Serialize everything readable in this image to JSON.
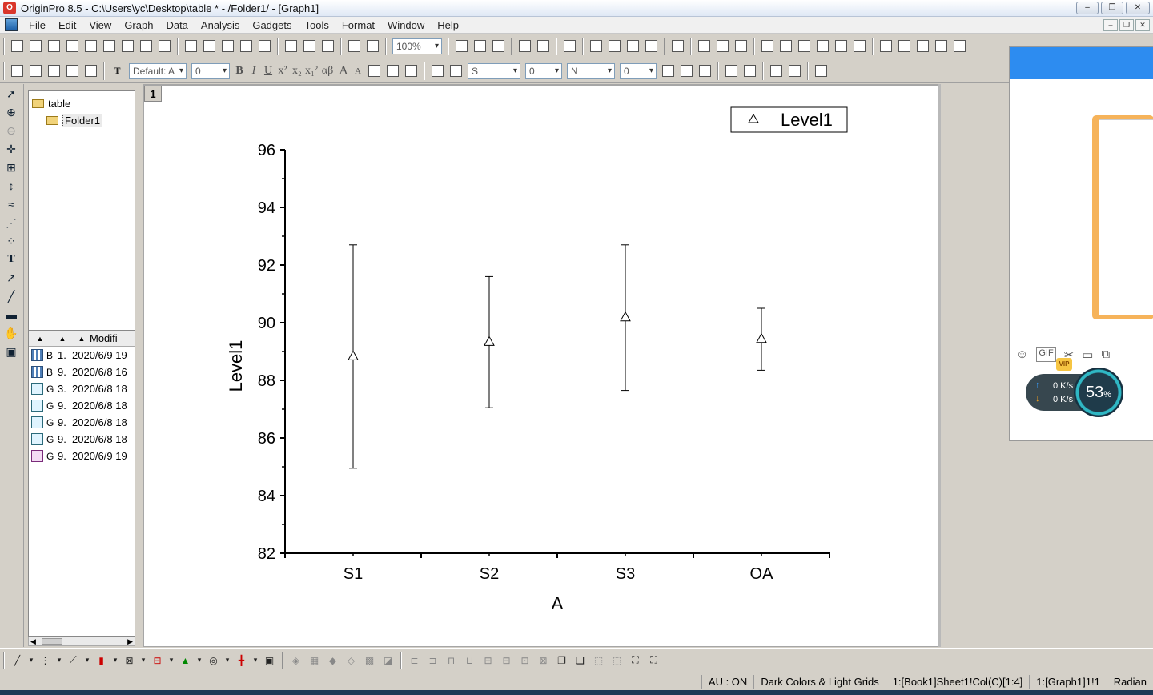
{
  "window": {
    "title": "OriginPro 8.5 - C:\\Users\\yc\\Desktop\\table * - /Folder1/ - [Graph1]",
    "controls": {
      "minimize": "–",
      "restore": "❐",
      "close": "✕"
    }
  },
  "menu": {
    "items": [
      "File",
      "Edit",
      "View",
      "Graph",
      "Data",
      "Analysis",
      "Gadgets",
      "Tools",
      "Format",
      "Window",
      "Help"
    ]
  },
  "toolbar": {
    "zoom_value": "100%",
    "font_value": "Default: A",
    "size_value": "0",
    "line_style_value": "S",
    "line_width_value": "0",
    "fill_value": "N",
    "fill_width_value": "0",
    "fmt_bold": "B",
    "fmt_italic": "I",
    "fmt_underline": "U",
    "fmt_sup": "x²",
    "fmt_sub": "x₂",
    "fmt_supsub": "x₁²",
    "fmt_greek": "αβ",
    "fmt_grow": "A",
    "fmt_shrink": "A"
  },
  "explorer": {
    "tree": [
      {
        "label": "table"
      },
      {
        "label": "Folder1"
      }
    ],
    "list_header_modified": "Modifi",
    "rows": [
      {
        "icon": "workbook",
        "name": "B",
        "num": "1.",
        "modified": "2020/6/9 19"
      },
      {
        "icon": "workbook",
        "name": "B",
        "num": "9.",
        "modified": "2020/6/8 16"
      },
      {
        "icon": "graph",
        "name": "G",
        "num": "3.",
        "modified": "2020/6/8 18"
      },
      {
        "icon": "graph",
        "name": "G",
        "num": "9.",
        "modified": "2020/6/8 18"
      },
      {
        "icon": "graph",
        "name": "G",
        "num": "9.",
        "modified": "2020/6/8 18"
      },
      {
        "icon": "graph",
        "name": "G",
        "num": "9.",
        "modified": "2020/6/8 18"
      },
      {
        "icon": "graph-pink",
        "name": "G",
        "num": "9.",
        "modified": "2020/6/9 19"
      }
    ]
  },
  "graph": {
    "layer_label": "1"
  },
  "chart_data": {
    "type": "scatter",
    "categories": [
      "S1",
      "S2",
      "S3",
      "OA"
    ],
    "series": [
      {
        "name": "Level1",
        "marker": "open-triangle",
        "values": [
          88.85,
          89.35,
          90.2,
          89.45
        ],
        "error_upper": [
          92.7,
          91.6,
          92.7,
          90.5
        ],
        "error_lower": [
          84.95,
          87.05,
          87.65,
          88.35
        ]
      }
    ],
    "xlabel": "A",
    "ylabel": "Level1",
    "ylim": [
      82,
      96
    ],
    "yticks": [
      "82",
      "84",
      "86",
      "88",
      "90",
      "92",
      "94",
      "96"
    ],
    "legend": {
      "label": "Level1",
      "placement": "top-right"
    },
    "grid": false
  },
  "side_panel": {
    "net_up": "0 K/s",
    "net_down": "0 K/s",
    "percent": "53",
    "percent_unit": "%",
    "vip": "VIP",
    "gif_label": "GIF"
  },
  "status": {
    "au": "AU : ON",
    "theme": "Dark Colors & Light Grids",
    "active_col": "1:[Book1]Sheet1!Col(C)[1:4]",
    "active_graph": "1:[Graph1]1!1",
    "angle": "Radian"
  }
}
